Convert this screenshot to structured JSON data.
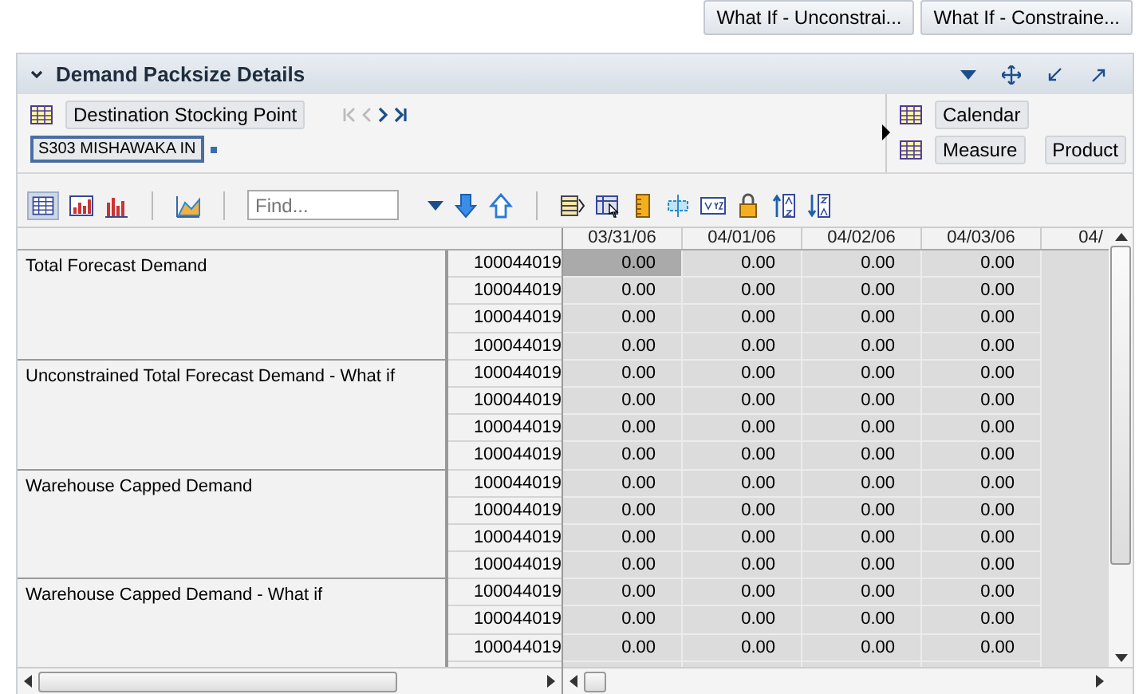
{
  "top_buttons": [
    "What If - Unconstrai...",
    "What If - Constraine..."
  ],
  "panel": {
    "title": "Demand Packsize Details",
    "context": {
      "dimension": "Destination Stocking Point",
      "value": "S303 MISHAWAKA IN",
      "right_dimensions": [
        "Calendar",
        "Measure",
        "Product"
      ]
    },
    "toolbar": {
      "find_placeholder": "Find..."
    },
    "grid": {
      "columns": [
        "03/31/06",
        "04/01/06",
        "04/02/06",
        "04/03/06",
        "04/"
      ],
      "groups": [
        {
          "label": "Total Forecast Demand",
          "rows": [
            {
              "id": "100044019",
              "cells": [
                {
                  "value": "0.00",
                  "selected": true
                },
                {
                  "value": "0.00",
                  "selected": false
                },
                {
                  "value": "0.00",
                  "selected": false
                },
                {
                  "value": "0.00",
                  "selected": false
                }
              ]
            },
            {
              "id": "100044019",
              "cells": [
                {
                  "value": "0.00",
                  "selected": false
                },
                {
                  "value": "0.00",
                  "selected": false
                },
                {
                  "value": "0.00",
                  "selected": false
                },
                {
                  "value": "0.00",
                  "selected": false
                }
              ]
            },
            {
              "id": "100044019",
              "cells": [
                {
                  "value": "0.00",
                  "selected": false
                },
                {
                  "value": "0.00",
                  "selected": false
                },
                {
                  "value": "0.00",
                  "selected": false
                },
                {
                  "value": "0.00",
                  "selected": false
                }
              ]
            },
            {
              "id": "100044019",
              "cells": [
                {
                  "value": "0.00",
                  "selected": false
                },
                {
                  "value": "0.00",
                  "selected": false
                },
                {
                  "value": "0.00",
                  "selected": false
                },
                {
                  "value": "0.00",
                  "selected": false
                }
              ]
            }
          ]
        },
        {
          "label": "Unconstrained Total Forecast Demand - What if",
          "rows": [
            {
              "id": "100044019",
              "cells": [
                {
                  "value": "0.00",
                  "selected": false
                },
                {
                  "value": "0.00",
                  "selected": false
                },
                {
                  "value": "0.00",
                  "selected": false
                },
                {
                  "value": "0.00",
                  "selected": false
                }
              ]
            },
            {
              "id": "100044019",
              "cells": [
                {
                  "value": "0.00",
                  "selected": false
                },
                {
                  "value": "0.00",
                  "selected": false
                },
                {
                  "value": "0.00",
                  "selected": false
                },
                {
                  "value": "0.00",
                  "selected": false
                }
              ]
            },
            {
              "id": "100044019",
              "cells": [
                {
                  "value": "0.00",
                  "selected": false
                },
                {
                  "value": "0.00",
                  "selected": false
                },
                {
                  "value": "0.00",
                  "selected": false
                },
                {
                  "value": "0.00",
                  "selected": false
                }
              ]
            },
            {
              "id": "100044019",
              "cells": [
                {
                  "value": "0.00",
                  "selected": false
                },
                {
                  "value": "0.00",
                  "selected": false
                },
                {
                  "value": "0.00",
                  "selected": false
                },
                {
                  "value": "0.00",
                  "selected": false
                }
              ]
            }
          ]
        },
        {
          "label": "Warehouse Capped Demand",
          "rows": [
            {
              "id": "100044019",
              "cells": [
                {
                  "value": "0.00",
                  "selected": false
                },
                {
                  "value": "0.00",
                  "selected": false
                },
                {
                  "value": "0.00",
                  "selected": false
                },
                {
                  "value": "0.00",
                  "selected": false
                }
              ]
            },
            {
              "id": "100044019",
              "cells": [
                {
                  "value": "0.00",
                  "selected": false
                },
                {
                  "value": "0.00",
                  "selected": false
                },
                {
                  "value": "0.00",
                  "selected": false
                },
                {
                  "value": "0.00",
                  "selected": false
                }
              ]
            },
            {
              "id": "100044019",
              "cells": [
                {
                  "value": "0.00",
                  "selected": false
                },
                {
                  "value": "0.00",
                  "selected": false
                },
                {
                  "value": "0.00",
                  "selected": false
                },
                {
                  "value": "0.00",
                  "selected": false
                }
              ]
            },
            {
              "id": "100044019",
              "cells": [
                {
                  "value": "0.00",
                  "selected": false
                },
                {
                  "value": "0.00",
                  "selected": false
                },
                {
                  "value": "0.00",
                  "selected": false
                },
                {
                  "value": "0.00",
                  "selected": false
                }
              ]
            }
          ]
        },
        {
          "label": "Warehouse Capped Demand - What if",
          "rows": [
            {
              "id": "100044019",
              "cells": [
                {
                  "value": "0.00",
                  "selected": false
                },
                {
                  "value": "0.00",
                  "selected": false
                },
                {
                  "value": "0.00",
                  "selected": false
                },
                {
                  "value": "0.00",
                  "selected": false
                }
              ]
            },
            {
              "id": "100044019",
              "cells": [
                {
                  "value": "0.00",
                  "selected": false
                },
                {
                  "value": "0.00",
                  "selected": false
                },
                {
                  "value": "0.00",
                  "selected": false
                },
                {
                  "value": "0.00",
                  "selected": false
                }
              ]
            },
            {
              "id": "100044019",
              "cells": [
                {
                  "value": "0.00",
                  "selected": false
                },
                {
                  "value": "0.00",
                  "selected": false
                },
                {
                  "value": "0.00",
                  "selected": false
                },
                {
                  "value": "0.00",
                  "selected": false
                }
              ]
            }
          ]
        }
      ]
    }
  }
}
